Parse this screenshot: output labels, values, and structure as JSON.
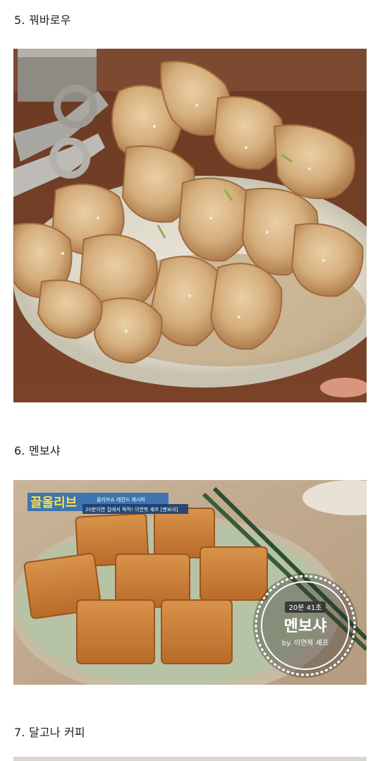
{
  "sections": [
    {
      "heading": "5. 꿔바로우"
    },
    {
      "heading": "6. 멘보샤",
      "overlay": {
        "show_logo": "끌올리브",
        "show_sub": "올리브쇼 레전드 레시피",
        "show_caption": "20분이면 집에서 뚝딱! 이연복 셰프 [멘보샤]",
        "timer": "20분 41초",
        "dish_name": "멘보샤",
        "chef": "by. 이연복 셰프"
      }
    },
    {
      "heading": "7. 달고나 커피"
    }
  ]
}
